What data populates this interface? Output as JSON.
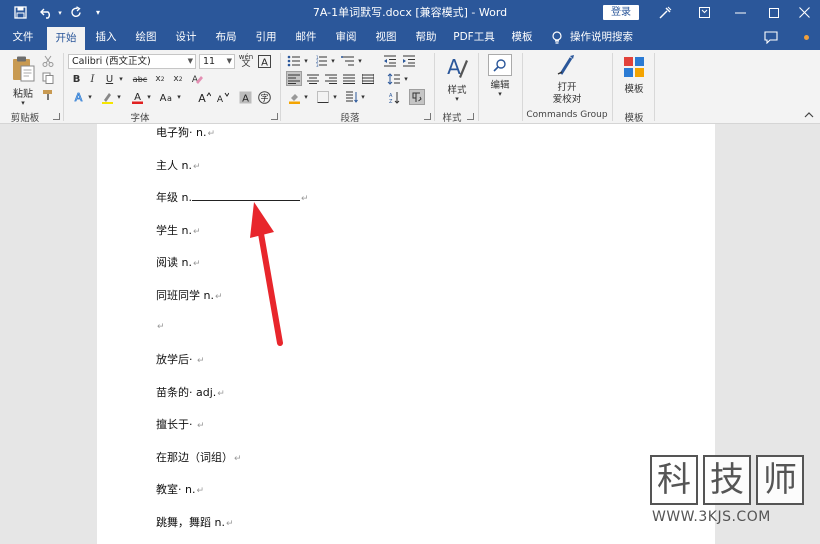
{
  "titlebar": {
    "title": "7A-1单词默写.docx [兼容模式] - Word",
    "login": "登录"
  },
  "tabs": [
    {
      "label": "文件"
    },
    {
      "label": "开始"
    },
    {
      "label": "插入"
    },
    {
      "label": "绘图"
    },
    {
      "label": "设计"
    },
    {
      "label": "布局"
    },
    {
      "label": "引用"
    },
    {
      "label": "邮件"
    },
    {
      "label": "审阅"
    },
    {
      "label": "视图"
    },
    {
      "label": "帮助"
    },
    {
      "label": "PDF工具"
    },
    {
      "label": "模板"
    }
  ],
  "active_tab": "开始",
  "tell_me": "操作说明搜索",
  "ribbon": {
    "clipboard": {
      "paste": "粘贴",
      "label": "剪贴板"
    },
    "font": {
      "name": "Calibri (西文正文)",
      "size": "11",
      "label": "字体",
      "wen": "wén"
    },
    "paragraph": {
      "label": "段落"
    },
    "styles": {
      "button": "样式",
      "label": "样式"
    },
    "editing": {
      "button": "编辑"
    },
    "commands": {
      "open": "打开",
      "proof": "爱校对",
      "label": "Commands Group"
    },
    "template": {
      "button": "模板",
      "label": "模板"
    }
  },
  "document": {
    "paragraphs": [
      {
        "text": "电子狗· n."
      },
      {
        "text": "主人 n."
      },
      {
        "text": "年级 n."
      },
      {
        "text": "学生 n."
      },
      {
        "text": "阅读 n."
      },
      {
        "text": "同班同学 n."
      },
      {
        "text": ""
      },
      {
        "text": "放学后· "
      },
      {
        "text": "苗条的· adj."
      },
      {
        "text": "擅长于· "
      },
      {
        "text": "在那边（词组）"
      },
      {
        "text": "教室· n."
      },
      {
        "text": "跳舞，舞蹈 n."
      }
    ],
    "para_mark": "↵"
  },
  "watermark": {
    "chars": [
      "科",
      "技",
      "师"
    ],
    "url": "WWW.3KJS.COM"
  },
  "colors": {
    "word_blue": "#2b579a",
    "arrow_red": "#e8262c"
  }
}
